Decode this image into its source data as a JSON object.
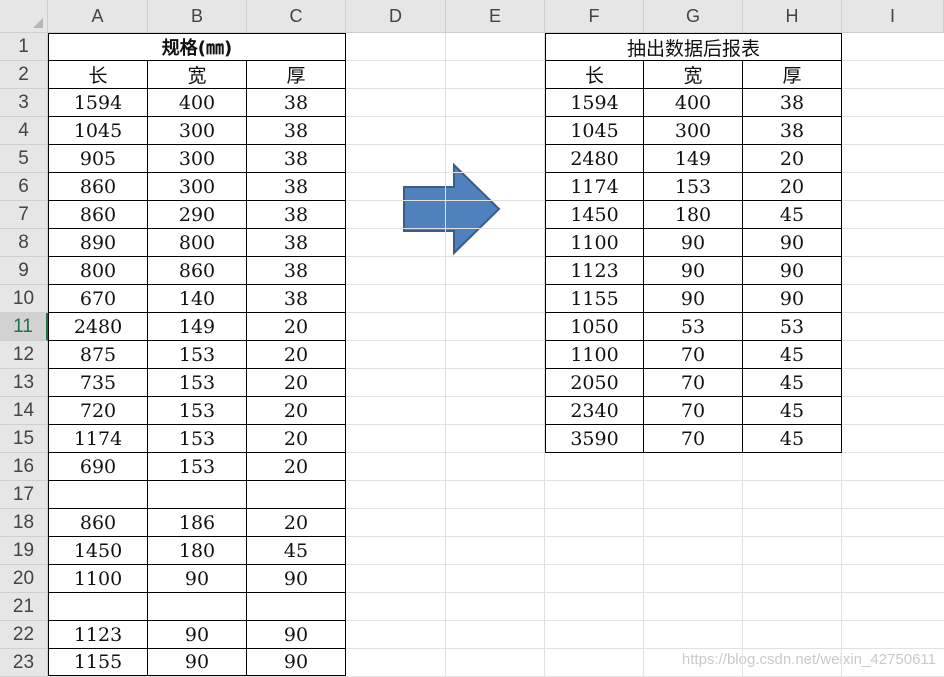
{
  "columns": [
    "A",
    "B",
    "C",
    "D",
    "E",
    "F",
    "G",
    "H",
    "I"
  ],
  "rows": [
    "1",
    "2",
    "3",
    "4",
    "5",
    "6",
    "7",
    "8",
    "9",
    "10",
    "11",
    "12",
    "13",
    "14",
    "15",
    "16",
    "17",
    "18",
    "19",
    "20",
    "21",
    "22",
    "23"
  ],
  "active_row": "11",
  "left_table": {
    "title": "规格(㎜)",
    "headers": [
      "长",
      "宽",
      "厚"
    ],
    "rows": [
      [
        "1594",
        "400",
        "38"
      ],
      [
        "1045",
        "300",
        "38"
      ],
      [
        "905",
        "300",
        "38"
      ],
      [
        "860",
        "300",
        "38"
      ],
      [
        "860",
        "290",
        "38"
      ],
      [
        "890",
        "800",
        "38"
      ],
      [
        "800",
        "860",
        "38"
      ],
      [
        "670",
        "140",
        "38"
      ],
      [
        "2480",
        "149",
        "20"
      ],
      [
        "875",
        "153",
        "20"
      ],
      [
        "735",
        "153",
        "20"
      ],
      [
        "720",
        "153",
        "20"
      ],
      [
        "1174",
        "153",
        "20"
      ],
      [
        "690",
        "153",
        "20"
      ],
      [
        "",
        "",
        ""
      ],
      [
        "860",
        "186",
        "20"
      ],
      [
        "1450",
        "180",
        "45"
      ],
      [
        "1100",
        "90",
        "90"
      ],
      [
        "",
        "",
        ""
      ],
      [
        "1123",
        "90",
        "90"
      ],
      [
        "1155",
        "90",
        "90"
      ]
    ]
  },
  "right_table": {
    "title": "抽出数据后报表",
    "headers": [
      "长",
      "宽",
      "厚"
    ],
    "rows": [
      [
        "1594",
        "400",
        "38"
      ],
      [
        "1045",
        "300",
        "38"
      ],
      [
        "2480",
        "149",
        "20"
      ],
      [
        "1174",
        "153",
        "20"
      ],
      [
        "1450",
        "180",
        "45"
      ],
      [
        "1100",
        "90",
        "90"
      ],
      [
        "1123",
        "90",
        "90"
      ],
      [
        "1155",
        "90",
        "90"
      ],
      [
        "1050",
        "53",
        "53"
      ],
      [
        "1100",
        "70",
        "45"
      ],
      [
        "2050",
        "70",
        "45"
      ],
      [
        "2340",
        "70",
        "45"
      ],
      [
        "3590",
        "70",
        "45"
      ]
    ]
  },
  "watermark": "https://blog.csdn.net/weixin_42750611",
  "colors": {
    "arrow_fill": "#4f81bd",
    "arrow_stroke": "#385d8a",
    "active": "#217346"
  }
}
